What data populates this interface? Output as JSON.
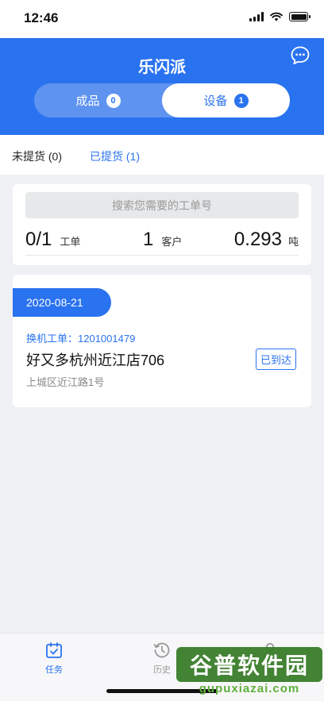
{
  "status_bar": {
    "time": "12:46"
  },
  "header": {
    "title": "乐闪派",
    "segments": [
      {
        "label": "成品",
        "count": "0"
      },
      {
        "label": "设备",
        "count": "1"
      }
    ],
    "selected_segment": "设备"
  },
  "subtabs": [
    {
      "label": "未提货 (0)"
    },
    {
      "label": "已提货 (1)"
    }
  ],
  "search": {
    "placeholder": "搜索您需要的工单号",
    "stats": [
      {
        "value": "0/1",
        "unit": "工单"
      },
      {
        "value": "1",
        "unit": "客户"
      },
      {
        "value": "0.293",
        "unit": "吨"
      }
    ]
  },
  "order": {
    "date": "2020-08-21",
    "number": "换机工单：1201001479",
    "name": "好又多杭州近江店706",
    "address": "上城区近江路1号",
    "status": "已到达"
  },
  "tabbar": {
    "items": [
      {
        "label": "任务",
        "icon": "calendar-check-icon"
      },
      {
        "label": "历史",
        "icon": "clock-history-icon"
      },
      {
        "label": "",
        "icon": "person-icon"
      }
    ]
  },
  "watermark": {
    "text": "谷普软件园",
    "url": "gupuxiazai.com"
  },
  "colors": {
    "primary": "#2a73f0",
    "segment_bg": "#5f93f0",
    "background": "#eef0f4"
  }
}
